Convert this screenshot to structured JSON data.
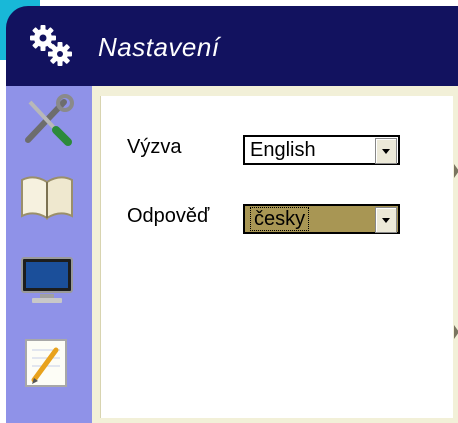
{
  "window": {
    "title": "Nastavení"
  },
  "sidebar": {
    "items": [
      {
        "name": "tools-icon"
      },
      {
        "name": "book-icon"
      },
      {
        "name": "monitor-icon"
      },
      {
        "name": "notepad-pencil-icon"
      }
    ]
  },
  "settings": {
    "prompt": {
      "label": "Výzva",
      "value": "English"
    },
    "answer": {
      "label": "Odpověď",
      "value": "česky"
    }
  },
  "colors": {
    "title_bar": "#12125f",
    "sidebar": "#8f92e8",
    "frame": "#f2f0d8",
    "selected_field": "#a89654",
    "accent": "#18b8d8"
  }
}
